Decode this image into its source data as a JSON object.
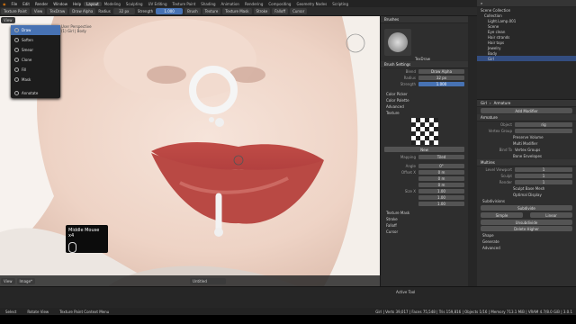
{
  "menu": [
    "File",
    "Edit",
    "Render",
    "Window",
    "Help"
  ],
  "workspaces": [
    "Layout",
    "Modeling",
    "Sculpting",
    "UV Editing",
    "Texture Paint",
    "Shading",
    "Animation",
    "Rendering",
    "Compositing",
    "Geometry Nodes",
    "Scripting"
  ],
  "active_workspace": "Layout",
  "scene": "Scene",
  "view_layer": "ViewLayer",
  "tool_header": {
    "mode": "Texture Paint",
    "view": "View",
    "brush": "TexDraw",
    "blend": "Draw Alpha",
    "radius_label": "Radius",
    "radius": "32 px",
    "strength_label": "Strength",
    "strength": "1.000",
    "brush_menu": "Brush",
    "texture": "Texture",
    "texture_mask": "Texture Mask",
    "stroke": "Stroke",
    "falloff": "Falloff",
    "cursor": "Cursor"
  },
  "viewport": {
    "title": "User Perspective",
    "object": "(1) Girl | Body"
  },
  "brush_menu": {
    "items": [
      "Draw",
      "Soften",
      "Smear",
      "Clone",
      "Fill",
      "Mask"
    ],
    "selected": "Draw",
    "annotate": "Annotate"
  },
  "overlay": {
    "middle_mouse": "Middle Mouse x4"
  },
  "viewport_footer": {
    "view": "View",
    "image": "Image*",
    "image_name": "Untitled"
  },
  "brushes_panel": {
    "title": "Brushes",
    "brush_name": "TexDraw"
  },
  "brush_settings": {
    "title": "Brush Settings",
    "blend_label": "Blend",
    "blend": "Draw Alpha",
    "radius_label": "Radius",
    "radius": "32 px",
    "strength_label": "Strength",
    "strength": "1.000"
  },
  "subpanels": [
    "Color Picker",
    "Color Palette",
    "Advanced",
    "Texture"
  ],
  "texture_settings": {
    "title": "New",
    "mapping_label": "Mapping",
    "mapping": "Tiled",
    "angle_label": "Angle",
    "angle": "0°",
    "offset_label": "Offset X",
    "offset_x": "0 m",
    "offset_y": "0 m",
    "offset_z": "0 m",
    "size_label": "Size X",
    "size_x": "1.00",
    "size_y": "1.00",
    "size_z": "1.00"
  },
  "lower_panels": [
    "Texture Mask",
    "Stroke",
    "Falloff",
    "Cursor"
  ],
  "outliner": {
    "title": "Scene Collection",
    "items": [
      "Collection",
      "Light.Lamp.001",
      "Scene",
      "Eye clean",
      "Hair strands",
      "Hair tops",
      "Jewelry",
      "Body",
      "Girl"
    ]
  },
  "properties": {
    "breadcrumb_obj": "Girl",
    "breadcrumb_mod": "Armature",
    "add_modifier": "Add Modifier",
    "mod1": "Armature",
    "object_label": "Object",
    "object": "rig",
    "vertex_group": "Vertex Group",
    "preserve_volume": "Preserve Volume",
    "multi_modifier": "Multi Modifier",
    "bind_to": "Bind To",
    "vertex_groups": "Vertex Groups",
    "bone_envelopes": "Bone Envelopes",
    "mod2": "Multires",
    "level_viewport": "Level Viewport",
    "level_viewport_val": "1",
    "sculpt": "Sculpt",
    "sculpt_val": "1",
    "render": "Render",
    "render_val": "1",
    "sculpt_base": "Sculpt Base Mesh",
    "optimal_display": "Optimal Display",
    "subdivisions": "Subdivisions",
    "subdivide": "Subdivide",
    "simple": "Simple",
    "linear": "Linear",
    "unsubdivide": "Unsubdivide",
    "delete_higher": "Delete Higher",
    "shape": "Shape",
    "generate": "Generate",
    "advanced": "Advanced"
  },
  "status": {
    "left": "Select",
    "mid": "Rotate View",
    "right": "Texture Paint Context Menu",
    "stats": "Girl | Verts 39,017 | Faces 75,548 | Tris 159,816 | Objects 1/16 | Memory 713.1 MiB | VRAM 4.7/8.0 GiB | 3.0.1"
  },
  "active_tool": "Active Tool"
}
